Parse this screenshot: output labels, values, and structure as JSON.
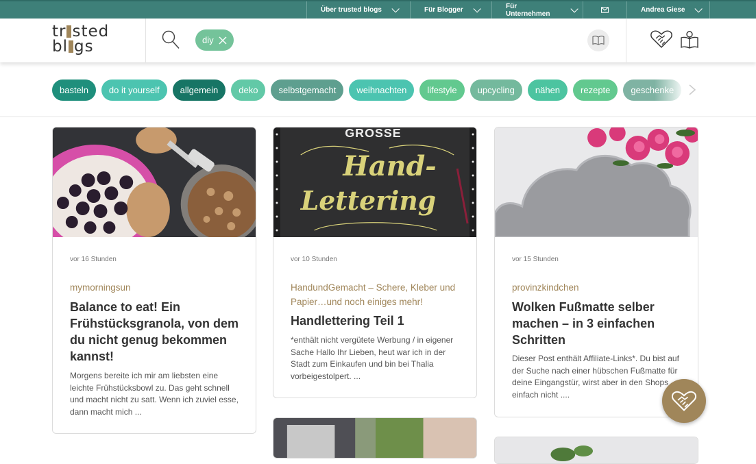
{
  "topnav": {
    "items": [
      "Über trusted blogs",
      "Für Blogger",
      "Für Unternehmen",
      "Andrea Giese"
    ],
    "mail_icon": "mail-icon"
  },
  "header": {
    "logo_line1": "tr",
    "logo_line1_end": "sted",
    "logo_line2": "bl",
    "logo_line2_end": "gs",
    "active_filter": "diy",
    "icons": [
      "search-icon",
      "close-icon",
      "book-icon",
      "handshake-heart-icon",
      "map-book-icon"
    ]
  },
  "colors": {
    "topbar": "#3e8079",
    "brand_gold": "#a0865a",
    "tag_colors": [
      "#1f8f7c",
      "#4cc4b0",
      "#177565",
      "#62c9a7",
      "#5e9f8f",
      "#4cc4b0",
      "#62c98f",
      "#74b99d",
      "#4cc4a0",
      "#62c98f",
      "#7fb3a3"
    ]
  },
  "tags": [
    "basteln",
    "do it yourself",
    "allgemein",
    "deko",
    "selbstgemacht",
    "weihnachten",
    "lifestyle",
    "upcycling",
    "nähen",
    "rezepte",
    "geschenke"
  ],
  "cards": [
    {
      "time": "vor 16 Stunden",
      "source": "mymorningsun",
      "title": "Balance to eat! Ein Frühstücksgranola, von dem du nicht genug bekommen kannst!",
      "excerpt": "Morgens bereite ich mir am liebsten eine leichte Frühstücksbowl zu. Das geht schnell und macht nicht zu satt. Wenn ich zuviel esse, dann macht mich ..."
    },
    {
      "time": "vor 10 Stunden",
      "source": "HandundGemacht – Schere, Kleber und Papier…und noch einiges mehr!",
      "title": "Handlettering Teil 1",
      "excerpt": "*enthält nicht vergütete Werbung / in eigener Sache   Hallo Ihr Lieben, heut war ich in der Stadt zum Einkaufen und bin bei Thalia vorbeigestolpert. ...",
      "image_text_top": "GROSSE",
      "image_text_mid": "Hand-",
      "image_text_bottom": "Lettering"
    },
    {
      "time": "vor 15 Stunden",
      "source": "provinzkindchen",
      "title": "Wolken Fußmatte selber machen – in 3 einfachen Schritten",
      "excerpt": "Dieser Post enthält Affiliate-Links*. Du bist auf der Suche nach einer hübschen Fußmatte für deine Eingangstür, wirst aber in den Shops einfach nicht ...."
    }
  ]
}
